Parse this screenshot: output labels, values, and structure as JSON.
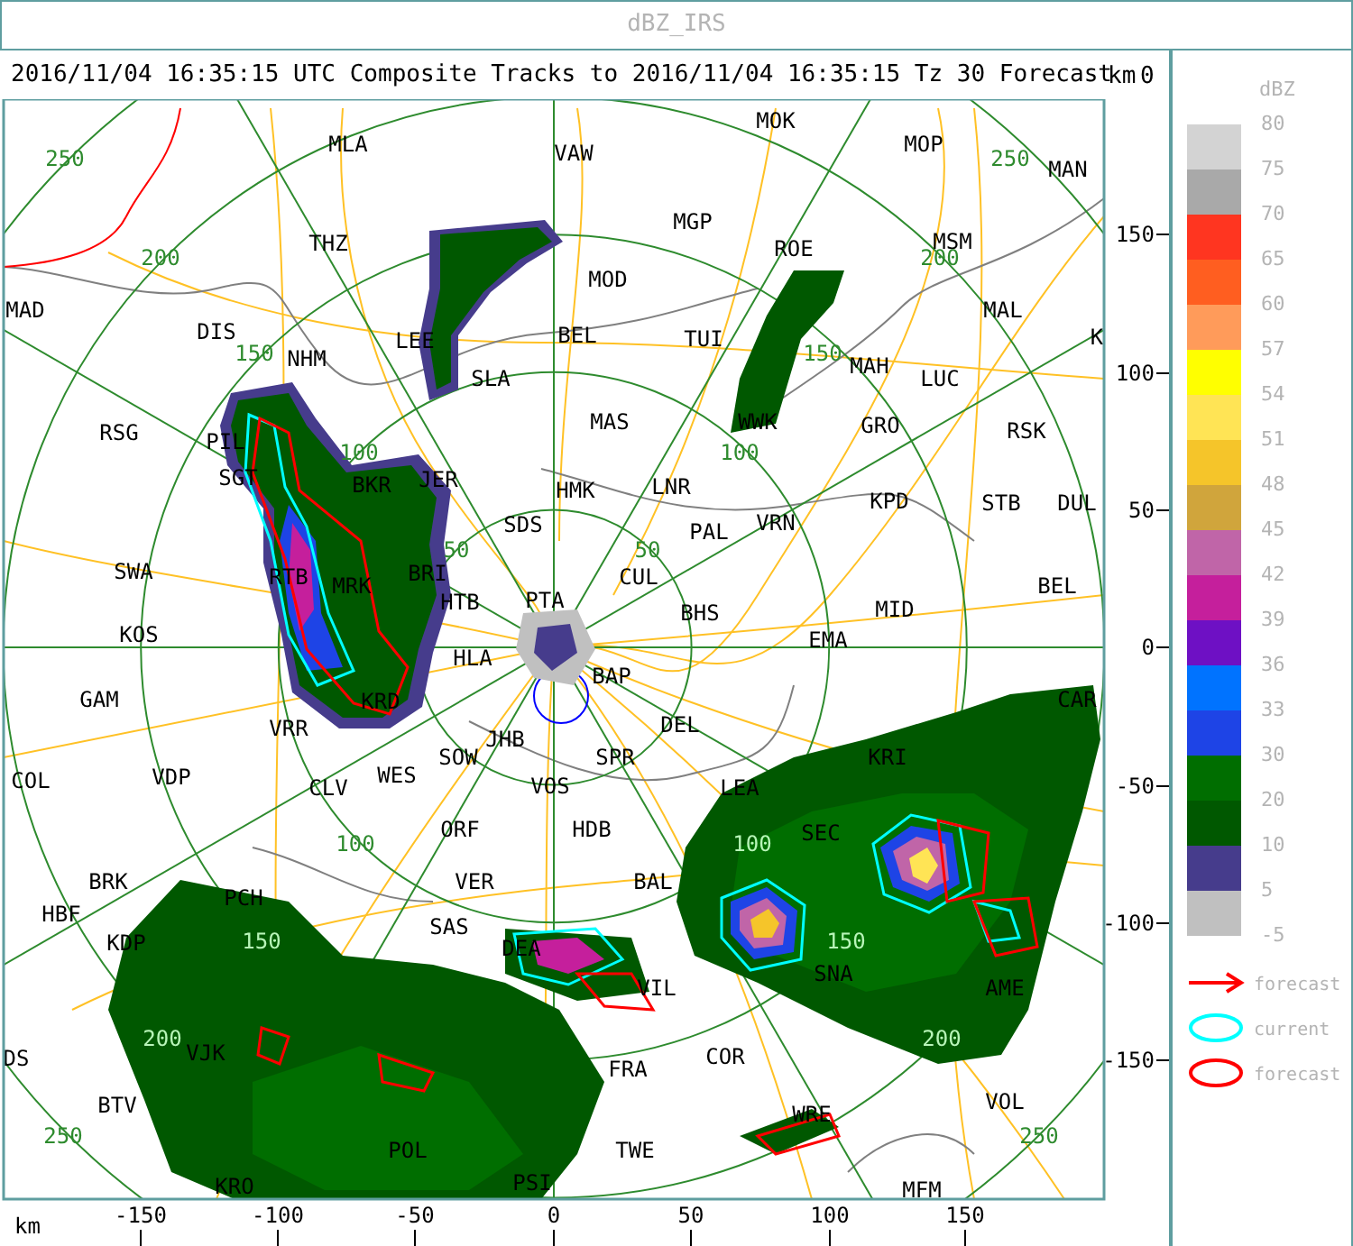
{
  "window": {
    "title": "dBZ_IRS"
  },
  "header": {
    "title": "2016/11/04 16:35:15 UTC Composite Tracks to 2016/11/04 16:35:15 Tz 30 Forecast",
    "unit": "km",
    "corner_value": "0"
  },
  "map": {
    "stations": [
      "MOK",
      "MLA",
      "VAW",
      "MOP",
      "MAN",
      "MGP",
      "THZ",
      "ROE",
      "MSM",
      "MOD",
      "MAD",
      "MAL",
      "DIS",
      "LEE",
      "BEL",
      "TUI",
      "K",
      "NHM",
      "MAH",
      "SLA",
      "LUC",
      "RSG",
      "PIL",
      "MAS",
      "WWK",
      "GRO",
      "RSK",
      "SGT",
      "BKR",
      "JER",
      "HMK",
      "LNR",
      "KPD",
      "STB",
      "DUL",
      "SDS",
      "PAL",
      "VRN",
      "SWA",
      "RTB",
      "MRK",
      "BRI",
      "CUL",
      "BEL",
      "HTB",
      "PTA",
      "BHS",
      "MID",
      "KOS",
      "EMA",
      "HLA",
      "BAP",
      "GAM",
      "KRD",
      "CAR",
      "VRR",
      "DEL",
      "JHB",
      "SOW",
      "SPR",
      "KRI",
      "COL",
      "VDP",
      "CLV",
      "WES",
      "VOS",
      "LEA",
      "ORF",
      "HDB",
      "SEC",
      "BRK",
      "VER",
      "BAL",
      "PCH",
      "HBF",
      "SAS",
      "KDP",
      "DEA",
      "SNA",
      "VIL",
      "AME",
      "DS",
      "VJK",
      "COR",
      "FRA",
      "BTV",
      "VOL",
      "WRE",
      "POL",
      "TWE",
      "KRO",
      "PSI",
      "MFM"
    ],
    "ring_labels": [
      "250",
      "250",
      "200",
      "200",
      "150",
      "150",
      "100",
      "100",
      "50",
      "50",
      "100",
      "100",
      "150",
      "150",
      "200",
      "200",
      "250",
      "250"
    ]
  },
  "x_axis": {
    "unit": "km",
    "ticks": [
      "-150",
      "-100",
      "-50",
      "0",
      "50",
      "100",
      "150"
    ]
  },
  "y_axis": {
    "ticks": [
      "150",
      "100",
      "50",
      "0",
      "-50",
      "-100",
      "-150"
    ]
  },
  "legend": {
    "title": "dBZ",
    "levels": [
      {
        "label": "80",
        "color": "#d3d3d3"
      },
      {
        "label": "75",
        "color": "#a9a9a9"
      },
      {
        "label": "70",
        "color": "#ff3520"
      },
      {
        "label": "65",
        "color": "#ff5e20"
      },
      {
        "label": "60",
        "color": "#ff9b5a"
      },
      {
        "label": "57",
        "color": "#ffff00"
      },
      {
        "label": "54",
        "color": "#ffe455"
      },
      {
        "label": "51",
        "color": "#f5c52a"
      },
      {
        "label": "48",
        "color": "#d0a53c"
      },
      {
        "label": "45",
        "color": "#c065a8"
      },
      {
        "label": "42",
        "color": "#c51f9c"
      },
      {
        "label": "39",
        "color": "#6e10c4"
      },
      {
        "label": "36",
        "color": "#0073ff"
      },
      {
        "label": "33",
        "color": "#1e44e6"
      },
      {
        "label": "30",
        "color": "#006e00"
      },
      {
        "label": "20",
        "color": "#005800"
      },
      {
        "label": "10",
        "color": "#463c8c"
      },
      {
        "label": "5",
        "color": "#c0c0c0"
      },
      {
        "label": "-5"
      }
    ],
    "symbols": [
      {
        "kind": "arrow",
        "color": "#ff0000",
        "label": "forecast"
      },
      {
        "kind": "ellipse",
        "color": "#00ffff",
        "label": "current"
      },
      {
        "kind": "ellipse",
        "color": "#ff0000",
        "label": "forecast"
      }
    ]
  }
}
